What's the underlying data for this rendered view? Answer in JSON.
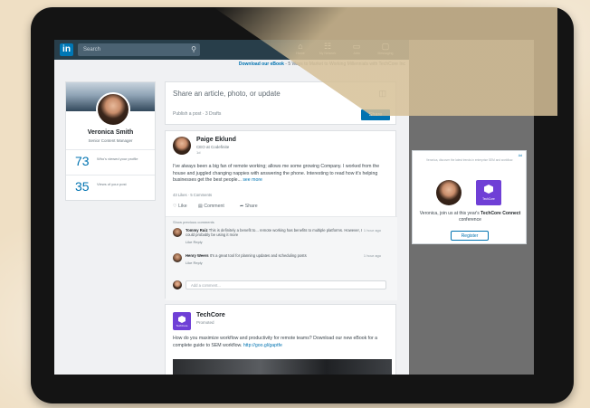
{
  "nav": {
    "logo": "in",
    "search_placeholder": "Search",
    "items": [
      {
        "label": "Home",
        "icon": "home-icon",
        "glyph": "⌂"
      },
      {
        "label": "My Network",
        "icon": "network-icon",
        "glyph": "☷"
      },
      {
        "label": "Jobs",
        "icon": "jobs-icon",
        "glyph": "▭"
      },
      {
        "label": "Messaging",
        "icon": "messaging-icon",
        "glyph": "▢"
      }
    ]
  },
  "promo": {
    "link": "Download our eBook",
    "text": " - 5 Ways to Market to Working Millennials with TechCore Inc"
  },
  "profile": {
    "name": "Veronica Smith",
    "title": "Senior Content Manager",
    "stats": [
      {
        "value": "73",
        "label": "Who's viewed your profile"
      },
      {
        "value": "35",
        "label": "Views of your post"
      }
    ]
  },
  "share": {
    "prompt": "Share an article, photo, or update",
    "sub": "Publish a post · 3 Drafts",
    "button": "Share"
  },
  "post": {
    "author": "Paige Eklund",
    "headline": "CEO at Codefinite",
    "time": "1d",
    "body": "I've always been a big fan of remote working; allows me some growing Company. I worked from the house and juggled changing nappies with answering the phone. Interesting to read how it's helping businesses get the best people...",
    "more": "see more",
    "stats": "43 Likes · 5 Comments",
    "actions": [
      "Like",
      "Comment",
      "Share"
    ],
    "prev_comments": "Show previous comments",
    "comments": [
      {
        "name": "Tommy Ruiz",
        "text": "This is definitely a benefit to... remote working has benefits to multiple platforms. However, I could probably be using it more",
        "time": "1 hour ago",
        "actions": "Like  Reply"
      },
      {
        "name": "Henry Weers",
        "text": "It's a great tool for planning updates and scheduling posts",
        "time": "1 hour ago",
        "actions": "Like  Reply"
      }
    ],
    "add_comment": "Add a comment..."
  },
  "sponsored": {
    "name": "TechCore",
    "promoted": "Promoted",
    "logo_label": "TechCore",
    "body": "How do you maximize workflow and productivity for remote teams? Download our new eBook for a complete guide to SEM workflow.",
    "link": "http://goo.gl/gaptfe"
  },
  "ad": {
    "label": "Ad",
    "top": "Veronica, discover the latest trends in enterprise SEM and workflow.",
    "text_pre": "Veronica, join us at this year's ",
    "text_bold": "TechCore Connect",
    "text_post": " conference",
    "logo_label": "TechCore",
    "button": "Register"
  },
  "colors": {
    "linkedin_blue": "#0073b1",
    "navbar": "#283e4a",
    "techcore_purple": "#6f3fd6"
  }
}
